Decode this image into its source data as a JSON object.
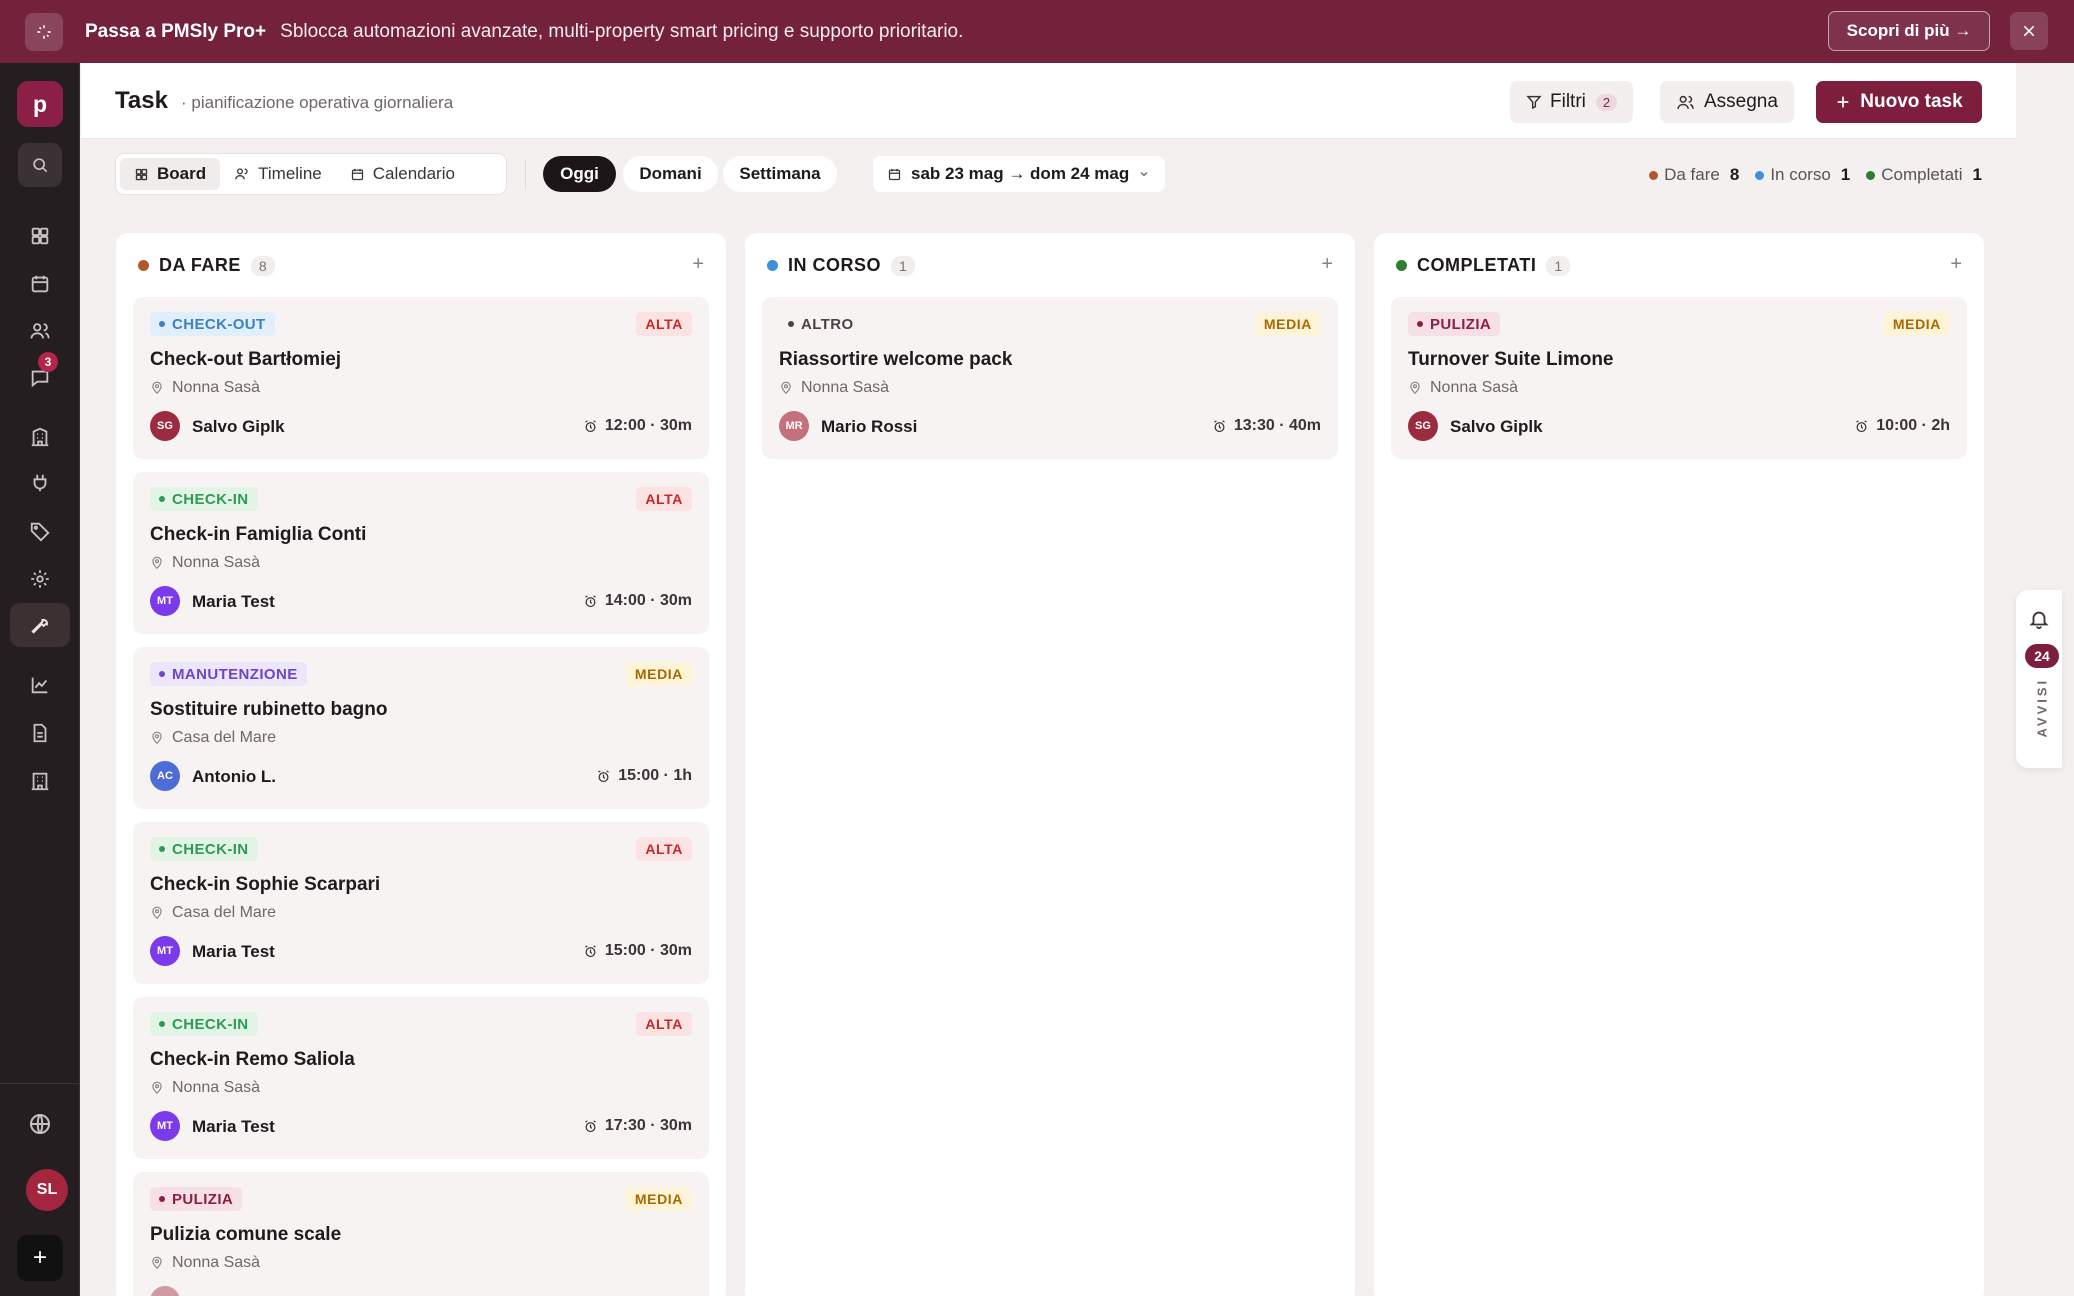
{
  "banner": {
    "title": "Passa a PMSly Pro+",
    "text": "Sblocca automazioni avanzate, multi-property smart pricing e supporto prioritario.",
    "cta": "Scopri di più →"
  },
  "sidebar": {
    "logo": "p",
    "messages_badge": "3",
    "avatar": "SL",
    "add": "+"
  },
  "header": {
    "title": "Task",
    "subtitle": "· pianificazione operativa giornaliera",
    "filters_label": "Filtri",
    "filters_count": "2",
    "assign_label": "Assegna",
    "new_label": "Nuovo task"
  },
  "toolbar": {
    "views": [
      "Board",
      "Timeline",
      "Calendario"
    ],
    "periods": [
      "Oggi",
      "Domani",
      "Settimana"
    ],
    "date_range": "sab 23 mag → dom 24 mag",
    "legend": [
      {
        "label": "Da fare",
        "count": "8",
        "color": "#b05a2a"
      },
      {
        "label": "In corso",
        "count": "1",
        "color": "#3d8fd8"
      },
      {
        "label": "Completati",
        "count": "1",
        "color": "#2e7d32"
      }
    ]
  },
  "columns": [
    {
      "title": "DA FARE",
      "count": "8",
      "color": "#b05a2a",
      "cards": [
        {
          "tag": "CHECK-OUT",
          "prio": "ALTA",
          "title": "Check-out Bartłomiej",
          "loc": "Nonna Sasà",
          "initials": "SG",
          "person": "Salvo Giplk",
          "time": "12:00 · 30m"
        },
        {
          "tag": "CHECK-IN",
          "prio": "ALTA",
          "title": "Check-in Famiglia Conti",
          "loc": "Nonna Sasà",
          "initials": "MT",
          "person": "Maria Test",
          "time": "14:00 · 30m"
        },
        {
          "tag": "MANUTENZIONE",
          "prio": "MEDIA",
          "title": "Sostituire rubinetto bagno",
          "loc": "Casa del Mare",
          "initials": "AC",
          "person": "Antonio L.",
          "time": "15:00 · 1h"
        },
        {
          "tag": "CHECK-IN",
          "prio": "ALTA",
          "title": "Check-in Sophie Scarpari",
          "loc": "Casa del Mare",
          "initials": "MT",
          "person": "Maria Test",
          "time": "15:00 · 30m"
        },
        {
          "tag": "CHECK-IN",
          "prio": "ALTA",
          "title": "Check-in Remo Saliola",
          "loc": "Nonna Sasà",
          "initials": "MT",
          "person": "Maria Test",
          "time": "17:30 · 30m"
        },
        {
          "tag": "PULIZIA",
          "prio": "MEDIA",
          "title": "Pulizia comune scale",
          "loc": "Nonna Sasà",
          "initials": "",
          "person": "",
          "time": ""
        }
      ]
    },
    {
      "title": "IN CORSO",
      "count": "1",
      "color": "#3d8fd8",
      "cards": [
        {
          "tag": "ALTRO",
          "prio": "MEDIA",
          "title": "Riassortire welcome pack",
          "loc": "Nonna Sasà",
          "initials": "MR",
          "person": "Mario Rossi",
          "time": "13:30 · 40m"
        }
      ]
    },
    {
      "title": "COMPLETATI",
      "count": "1",
      "color": "#2e7d32",
      "cards": [
        {
          "tag": "PULIZIA",
          "prio": "MEDIA",
          "title": "Turnover Suite Limone",
          "loc": "Nonna Sasà",
          "initials": "SG",
          "person": "Salvo Giplk",
          "time": "10:00 · 2h"
        }
      ]
    }
  ],
  "notifications": {
    "count": "24",
    "label": "AVVISI"
  }
}
